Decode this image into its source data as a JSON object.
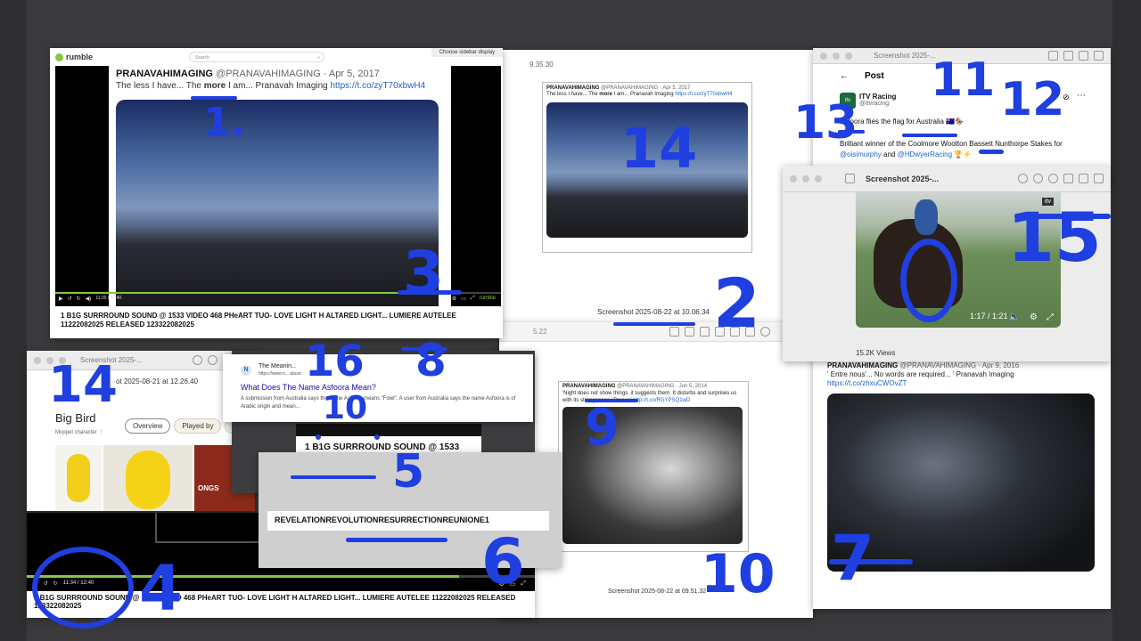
{
  "rumble": {
    "logo": "rumble",
    "search_placeholder": "Search",
    "sidebar_display": "Choose sidebar display",
    "tweet_name": "PRANAVAHIMAGING",
    "tweet_meta": "@PRANAVAHIMAGING · Apr 5, 2017",
    "tweet_text_before": "The less I have... The ",
    "tweet_text_bold": "more",
    "tweet_text_after": " I am... Pranavah Imaging ",
    "tweet_link": "https://t.co/zyT70xbwH4",
    "time": "11:20 / 12:40",
    "watermark": "rumble",
    "caption": "1 B1G SURRROUND SOUND @ 1533 VIDEO 468 PHeART TUO- LOVE LIGHT H ALTARED LIGHT... LUMIERE AUTELEE 11222082025 RELEASED 123322082025"
  },
  "preview14": {
    "tweet_name": "PRANAVAHIMAGING",
    "tweet_meta": "@PRANAVAHIMAGING · Apr 5, 2017",
    "tweet_text_before": "The less I have... The ",
    "tweet_text_bold": "more",
    "tweet_text_after": " I am... Pranavah Imaging ",
    "tweet_link": "https://t.co/zyT70xbwH4",
    "screenshot_label": "Screenshot 2025-08-22 at 10.06.34",
    "top_fragment": "9.35.30"
  },
  "twitter": {
    "title": "Screenshot 2025-...",
    "header": "Post",
    "account": "ITV Racing",
    "handle": "@itvracing",
    "line1": "Asfoora flies the flag for Australia 🇦🇺🏇",
    "line2": "Brilliant winner of the Coolmore Wootton Bassett Nunthorpe Stakes for",
    "mention1": "@oisimurphy",
    "and": " and ",
    "mention2": "@HDwyerRacing",
    "emoji": " 🏆⚡"
  },
  "video15": {
    "title": "Screenshot 2025-...",
    "time": "1:17 / 1:21",
    "views": "15.2K Views",
    "logo": "itv"
  },
  "tweet7": {
    "tweet_name": "PRANAVAHIMAGING",
    "tweet_meta": "@PRANAVAHIMAGING · Apr 9, 2016",
    "tweet_text": "' Entre nous'... No words are required... ' Pranavah Imaging",
    "tweet_link": "https://t.co/zhxuCWOvZT"
  },
  "kiss": {
    "tweet_name": "PRANAVAHIMAGING",
    "tweet_meta": "@PRANAVAHIMAGING · Jun 5, 2014",
    "tweet_text": "'Night does not show things, it suggests them. It disturbs and surprises us with its strangeness.' Brassaï ",
    "tweet_link": "http://t.co/RGYPSQ1wD",
    "screenshot_label": "Screenshot 2025-08-22 at 09.51.32",
    "top_fragment": "5.22"
  },
  "bigbird": {
    "title": "Screenshot 2025-...",
    "subtitle": "ot 2025-08-21 at 12.26.40",
    "name": "Big Bird",
    "desc": "Muppet character",
    "tabs": [
      "Overview",
      "Played by",
      "M"
    ],
    "img_label": "ONGS"
  },
  "google": {
    "site": "The Meanin...",
    "url": "https://www.n...                    about",
    "title": "What Does The Name Asfoora Mean?",
    "desc": "A submission from Australia says the name Asfoora means \"Fowl\". A user from Australia says the name Asfoora is of Arabic origin and mean..."
  },
  "caption5": {
    "text": "1 B1G SURRROUND SOUND @ 1533 123322082025"
  },
  "caption6": {
    "text": "REVELATIONREVOLUTIONRESURRECTIONREUNIONE1"
  },
  "bottom_player": {
    "time": "11:34 / 12:40",
    "caption_line1": "1 B1G SURRROUND SOUND @ 1533 VIDEO 468 PHeART TUO- LOVE LIGHT H ALTARED LIGHT... LUMIERE AUTELEE 11222082025 RELEASED",
    "caption_line2": "123322082025"
  },
  "annotations": [
    "1.",
    "2",
    "3",
    "4",
    "5",
    "6",
    "7",
    "8",
    "9",
    "10",
    "10",
    "11",
    "12",
    "13",
    "14",
    "14",
    "15",
    "16",
    "0"
  ],
  "colors": {
    "annotation": "#1f3fe0",
    "link": "#1d62c9",
    "rumble_green": "#85c742"
  }
}
